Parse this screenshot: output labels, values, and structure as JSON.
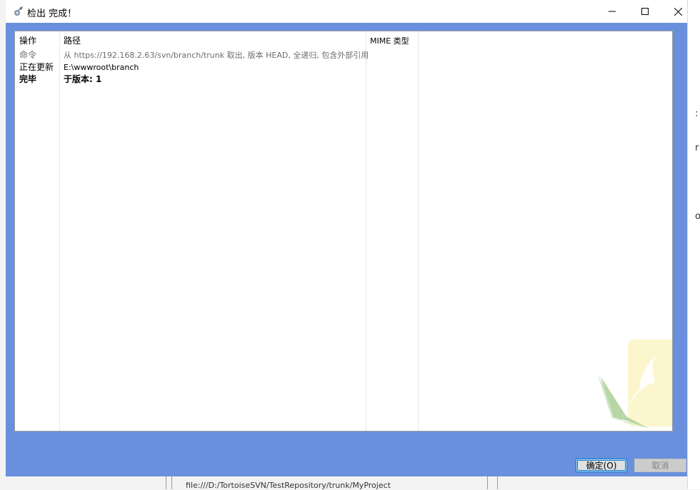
{
  "window": {
    "title": "检出 完成！",
    "controls": {
      "minimize": "minimize",
      "maximize": "maximize",
      "close": "close"
    }
  },
  "table": {
    "headers": {
      "action": "操作",
      "path": "路径",
      "mime": "MIME 类型"
    },
    "rows": [
      {
        "action": "命令",
        "path": "从 https://192.168.2.63/svn/branch/trunk 取出, 版本 HEAD, 全递归, 包含外部引用",
        "style": "gray"
      },
      {
        "action": "正在更新",
        "path": "E:\\wwwroot\\branch",
        "style": "normal"
      },
      {
        "action": "完毕",
        "path": "于版本: 1",
        "style": "bold"
      }
    ]
  },
  "buttons": {
    "ok": "确定(O)",
    "cancel": "取消"
  },
  "background_window": {
    "bottom_path": "file:///D:/TortoiseSVN/TestRepository/trunk/MyProject"
  },
  "colors": {
    "frame": "#6890dc",
    "accent": "#0078d7"
  }
}
